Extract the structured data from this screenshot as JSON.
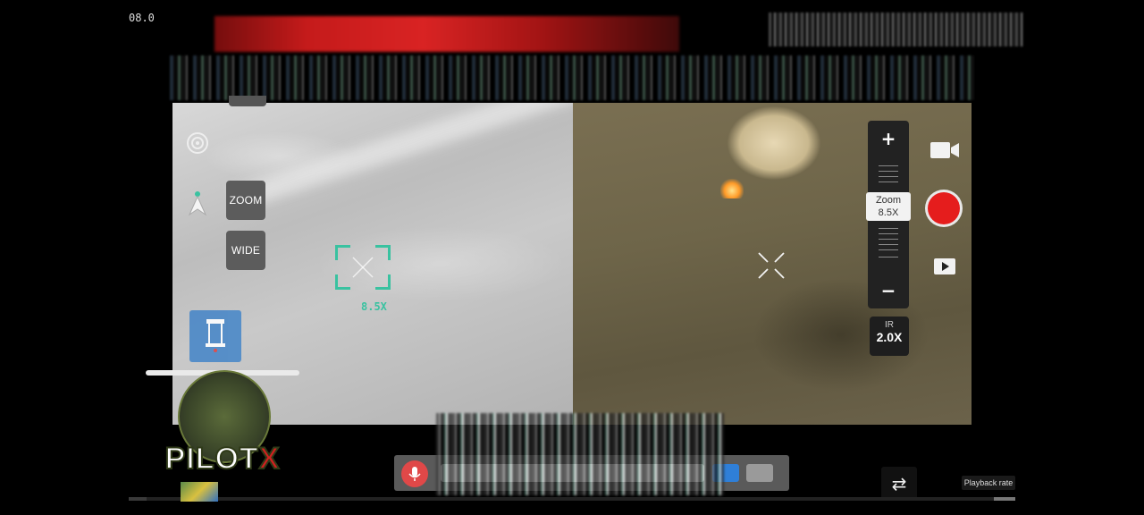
{
  "status_bar": {
    "code_text": "08.0"
  },
  "left_feed": {
    "zoom_button_label": "ZOOM",
    "wide_button_label": "WIDE",
    "reticle_zoom_label": "8.5X"
  },
  "right_feed": {
    "zoom_readout_title": "Zoom",
    "zoom_readout_value": "8.5X",
    "zoom_in_label": "+",
    "zoom_out_label": "−",
    "ir_label": "IR",
    "ir_value": "2.0X"
  },
  "player": {
    "playback_rate_label": "Playback rate",
    "swap_icon": "⇄"
  },
  "watermark": {
    "text_prefix": "PILOT",
    "text_suffix": "X"
  },
  "icons": {
    "satellite": "satellite-signal-icon",
    "compass": "navigation-arrow-icon",
    "video_camera": "video-camera-icon",
    "record": "record-icon",
    "playback": "playback-icon",
    "microphone": "microphone-icon",
    "tower": "tower-icon"
  },
  "colors": {
    "reticle": "#39c2a0",
    "record": "#e51d1d",
    "mic": "#e04848",
    "accent_blue": "#2f7fd8"
  },
  "progress": {
    "played_fraction": 0.02
  }
}
